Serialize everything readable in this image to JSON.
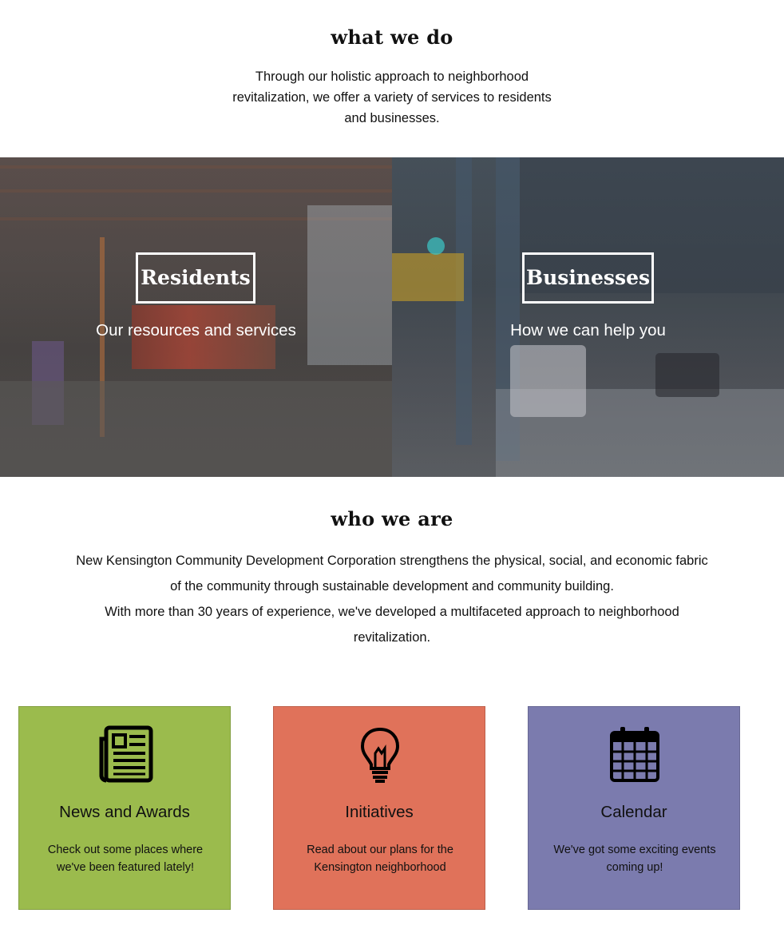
{
  "what_we_do": {
    "title": "what we do",
    "text": "Through our holistic approach to neighborhood revitalization, we offer a variety of services to residents and businesses."
  },
  "hero": {
    "residents": {
      "button": "Residents",
      "subtitle": "Our resources and services"
    },
    "businesses": {
      "button": "Businesses",
      "subtitle": "How we can help you"
    }
  },
  "who_we_are": {
    "title": "who we are",
    "paragraph1": "New Kensington Community Development Corporation strengthens the physical, social, and economic fabric of the community through sustainable development and community building.",
    "paragraph2": "With more than 30 years of experience, we've developed a multifaceted approach to neighborhood revitalization."
  },
  "cards": [
    {
      "title": "News and Awards",
      "text": "Check out some places where we've been featured lately!",
      "icon": "newspaper-icon",
      "color": "#9bbb4d"
    },
    {
      "title": "Initiatives",
      "text": "Read about our plans for the Kensington neighborhood",
      "icon": "lightbulb-icon",
      "color": "#e0725a"
    },
    {
      "title": "Calendar",
      "text": "We've got some exciting events coming up!",
      "icon": "calendar-icon",
      "color": "#7b7bae"
    }
  ]
}
